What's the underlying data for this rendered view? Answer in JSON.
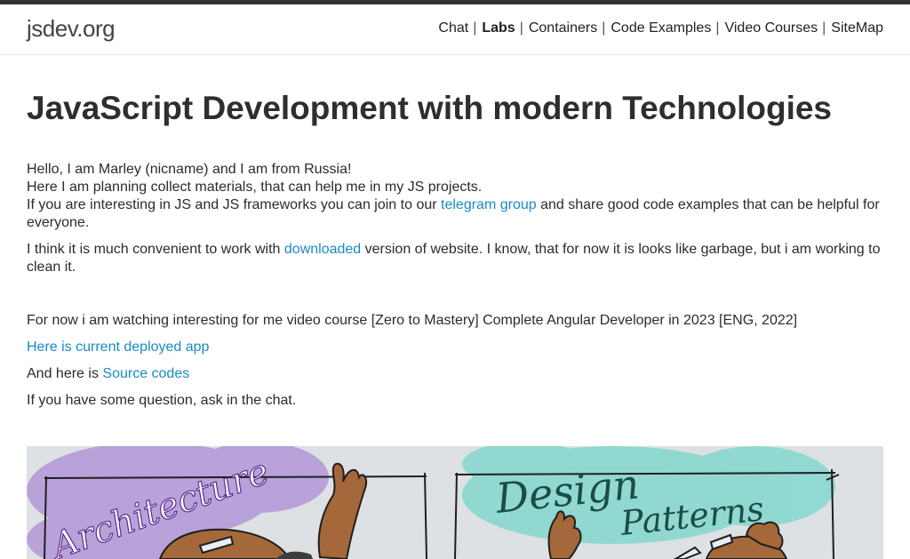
{
  "header": {
    "logo": "jsdev.org",
    "nav": [
      {
        "label": "Chat",
        "active": false
      },
      {
        "label": "Labs",
        "active": true
      },
      {
        "label": "Containers",
        "active": false
      },
      {
        "label": "Code Examples",
        "active": false
      },
      {
        "label": "Video Courses",
        "active": false
      },
      {
        "label": "SiteMap",
        "active": false
      }
    ],
    "separator": "|"
  },
  "main": {
    "title": "JavaScript Development with modern Technologies",
    "intro_line1": "Hello, I am Marley (nicname) and I am from Russia!",
    "intro_line2": "Here I am planning collect materials, that can help me in my JS projects.",
    "intro_line3_pre": "If you are interesting in JS and JS frameworks you can join to our ",
    "telegram_link": "telegram group",
    "intro_line3_post": " and share good code examples that can be helpful for everyone.",
    "download_pre": "I think it is much convenient to work with ",
    "download_link": "downloaded",
    "download_post": " version of website. I know, that for now it is looks like garbage, but i am working to clean it.",
    "course_text": "For now i am watching interesting for me video course [Zero to Mastery] Complete Angular Developer in 2023 [ENG, 2022]",
    "deployed_link": "Here is current deployed app",
    "source_pre": "And here is ",
    "source_link": "Source codes",
    "question_text": "If you have some question, ask in the chat."
  },
  "banner": {
    "left_text": "Architecture",
    "right_text_1": "Design",
    "right_text_2": "Patterns",
    "colors": {
      "accent_purple": "#9b6fd1",
      "accent_teal": "#5fd3c6",
      "ink": "#1a4d47",
      "skin": "#a5683a",
      "bg": "#dde1e3"
    }
  }
}
